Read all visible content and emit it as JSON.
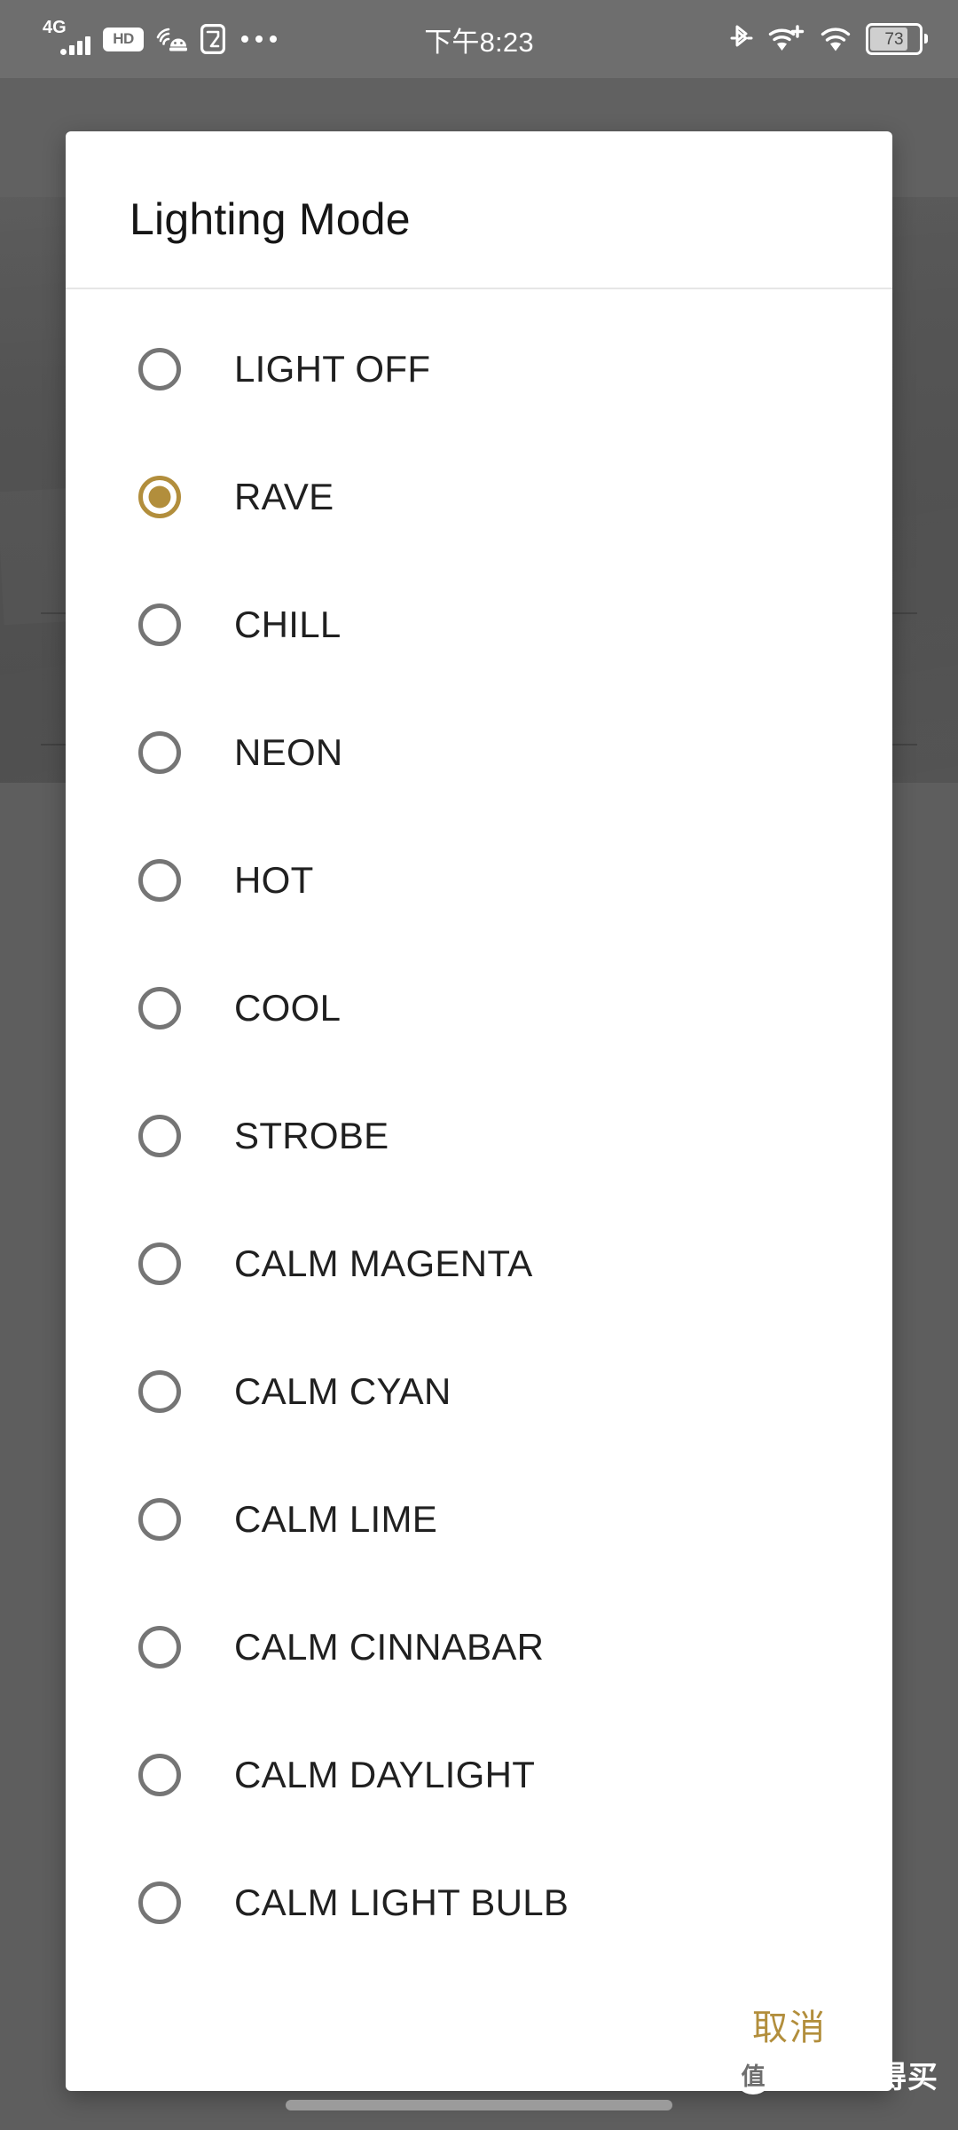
{
  "status_bar": {
    "network_type": "4G",
    "hd_badge": "HD",
    "icons": [
      "signal-bars-icon",
      "hd-icon",
      "hotspot-android-icon",
      "nfc-card-icon",
      "more-icons",
      "bluetooth-icon",
      "wifi-plus-icon",
      "wifi-icon",
      "battery-icon"
    ],
    "clock": "下午8:23",
    "battery_percent": "73"
  },
  "background_app": {
    "overflow_menu": "⋮"
  },
  "dialog": {
    "title": "Lighting Mode",
    "selected_value": "RAVE",
    "accent_color": "#b28e3c",
    "radio_color": "#757575",
    "options": [
      {
        "label": "LIGHT OFF",
        "selected": false
      },
      {
        "label": "RAVE",
        "selected": true
      },
      {
        "label": "CHILL",
        "selected": false
      },
      {
        "label": "NEON",
        "selected": false
      },
      {
        "label": "HOT",
        "selected": false
      },
      {
        "label": "COOL",
        "selected": false
      },
      {
        "label": "STROBE",
        "selected": false
      },
      {
        "label": "CALM MAGENTA",
        "selected": false
      },
      {
        "label": "CALM CYAN",
        "selected": false
      },
      {
        "label": "CALM LIME",
        "selected": false
      },
      {
        "label": "CALM CINNABAR",
        "selected": false
      },
      {
        "label": "CALM DAYLIGHT",
        "selected": false
      },
      {
        "label": "CALM LIGHT BULB",
        "selected": false
      }
    ],
    "cancel_label": "取消"
  },
  "watermark": {
    "logo_text": "值",
    "text": "什么值得买"
  }
}
